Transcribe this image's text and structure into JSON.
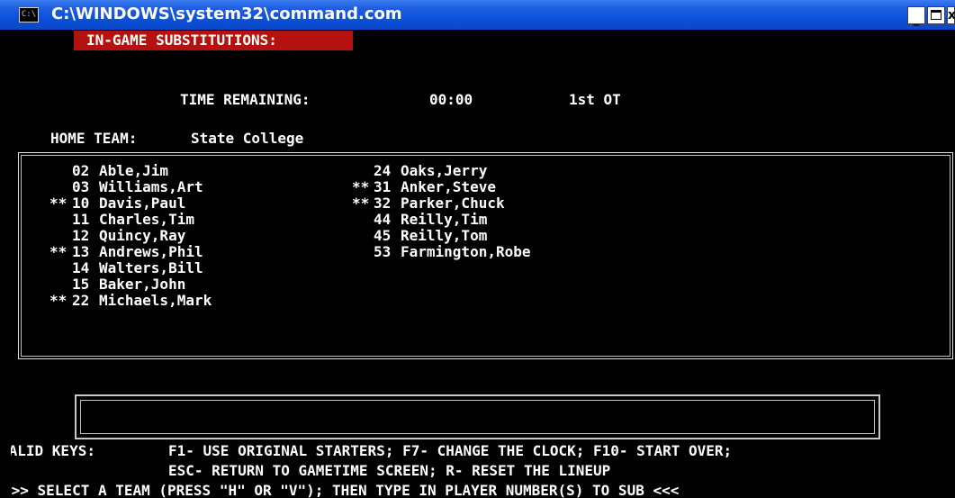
{
  "window": {
    "title": "C:\\WINDOWS\\system32\\command.com",
    "icon_label": "C:\\",
    "icon": "console-icon",
    "minimize_icon": "minimize-icon",
    "maximize_icon": "maximize-icon",
    "close_icon": "close-icon",
    "close_glyph": "x"
  },
  "colors": {
    "titlebar": "#0a4fd8",
    "console_bg": "#000000",
    "text": "#ffffff",
    "header_highlight": "#b3120f"
  },
  "screen": {
    "header": "IN-GAME SUBSTITUTIONS:",
    "time_label": "TIME REMAINING:",
    "time_value": "00:00",
    "period": "1st OT",
    "team_label": "HOME TEAM:",
    "team_name": "State College"
  },
  "roster": {
    "left": [
      {
        "marker": "",
        "number": "02",
        "name": "Able,Jim"
      },
      {
        "marker": "",
        "number": "03",
        "name": "Williams,Art"
      },
      {
        "marker": "**",
        "number": "10",
        "name": "Davis,Paul"
      },
      {
        "marker": "",
        "number": "11",
        "name": "Charles,Tim"
      },
      {
        "marker": "",
        "number": "12",
        "name": "Quincy,Ray"
      },
      {
        "marker": "**",
        "number": "13",
        "name": "Andrews,Phil"
      },
      {
        "marker": "",
        "number": "14",
        "name": "Walters,Bill"
      },
      {
        "marker": "",
        "number": "15",
        "name": "Baker,John"
      },
      {
        "marker": "**",
        "number": "22",
        "name": "Michaels,Mark"
      }
    ],
    "right": [
      {
        "marker": "",
        "number": "24",
        "name": "Oaks,Jerry"
      },
      {
        "marker": "**",
        "number": "31",
        "name": "Anker,Steve"
      },
      {
        "marker": "**",
        "number": "32",
        "name": "Parker,Chuck"
      },
      {
        "marker": "",
        "number": "44",
        "name": "Reilly,Tim"
      },
      {
        "marker": "",
        "number": "45",
        "name": "Reilly,Tom"
      },
      {
        "marker": "",
        "number": "53",
        "name": "Farmington,Robe"
      }
    ]
  },
  "input": {
    "value": ""
  },
  "footer": {
    "keys_label": "VALID KEYS:",
    "keys_line1": "F1- USE ORIGINAL STARTERS; F7- CHANGE THE CLOCK; F10- START OVER;",
    "keys_line2": "ESC- RETURN TO GAMETIME SCREEN; R- RESET THE LINEUP",
    "prompt": ">>> SELECT A TEAM (PRESS \"H\" OR \"V\"); THEN TYPE IN PLAYER NUMBER(S) TO SUB <<<"
  }
}
